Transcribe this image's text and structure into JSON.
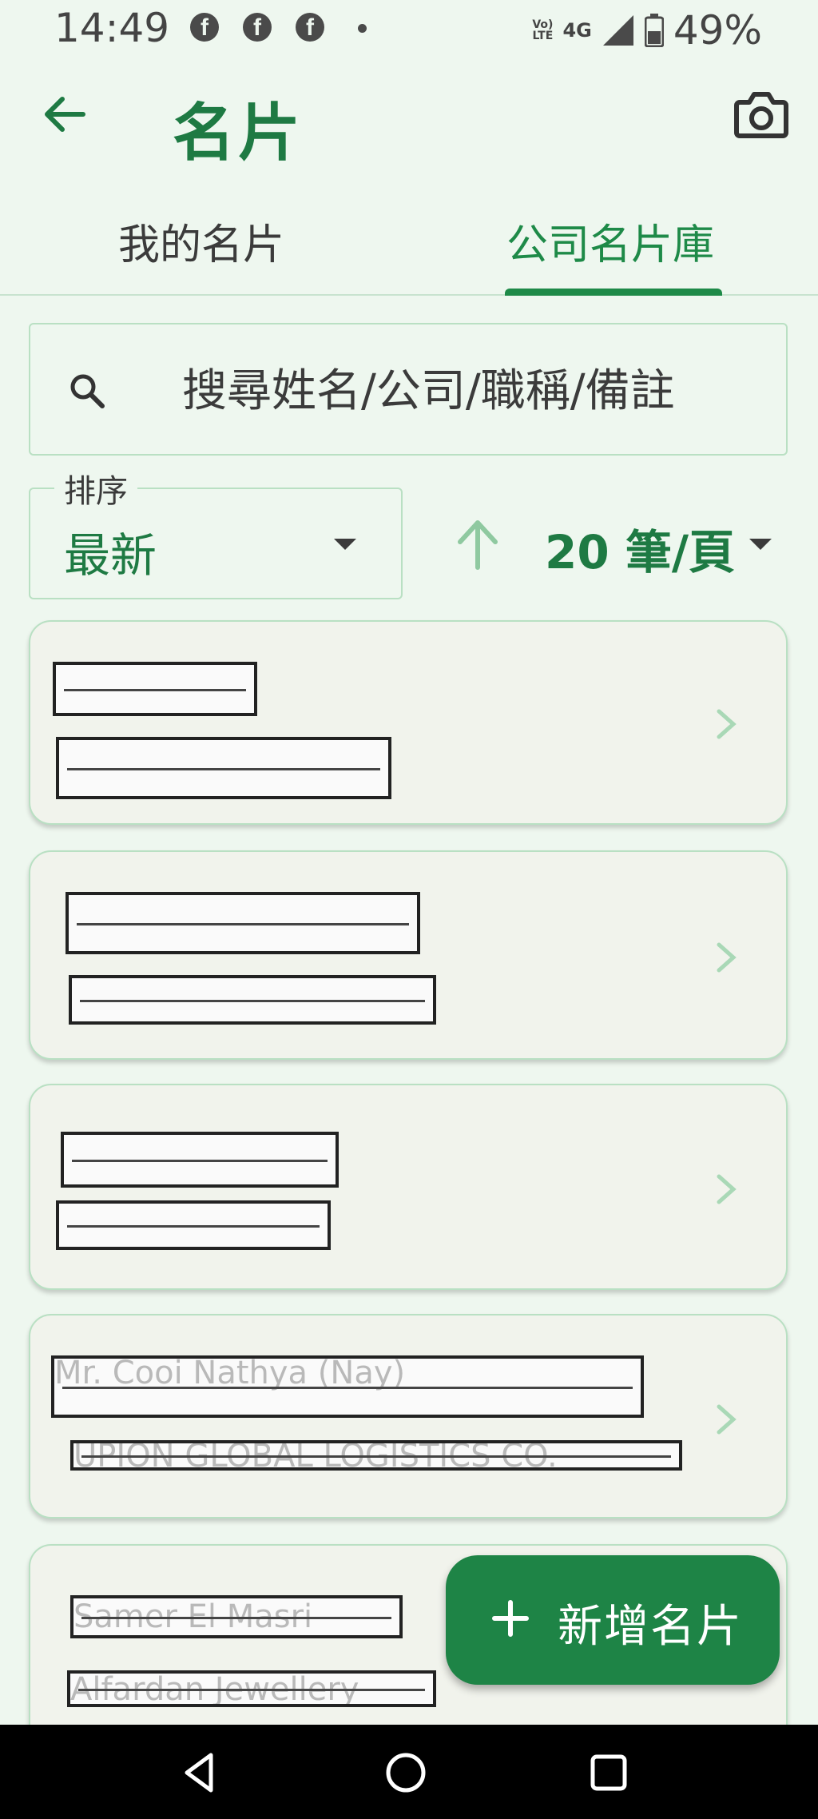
{
  "status_bar": {
    "time": "14:49",
    "notification_icons": [
      "facebook-icon",
      "facebook-icon",
      "facebook-icon",
      "dot-icon"
    ],
    "volte": "VoLTE",
    "network": "4G",
    "battery": "49%"
  },
  "header": {
    "title": "名片",
    "back_icon": "arrow-back-icon",
    "camera_icon": "camera-icon"
  },
  "tabs": [
    {
      "label": "我的名片",
      "active": false
    },
    {
      "label": "公司名片庫",
      "active": true
    }
  ],
  "search": {
    "placeholder": "搜尋姓名/公司/職稱/備註",
    "value": ""
  },
  "sort": {
    "label": "排序",
    "value": "最新",
    "direction": "ascending"
  },
  "paging": {
    "page_size": "20 筆/頁"
  },
  "cards": [
    {
      "name": "",
      "company": ""
    },
    {
      "name": "",
      "company": ""
    },
    {
      "name": "",
      "company": ""
    },
    {
      "name": "Mr. Cooi Nathya (Nay)",
      "company": "UPION GLOBAL LOGISTICS CO."
    },
    {
      "name": "Samer El Masri",
      "company": "Alfardan Jewellery"
    }
  ],
  "fab": {
    "label": "新增名片",
    "icon": "plus-icon"
  },
  "colors": {
    "accent": "#1e8a48",
    "background": "#eef7ef",
    "card": "#f1f3ec"
  }
}
